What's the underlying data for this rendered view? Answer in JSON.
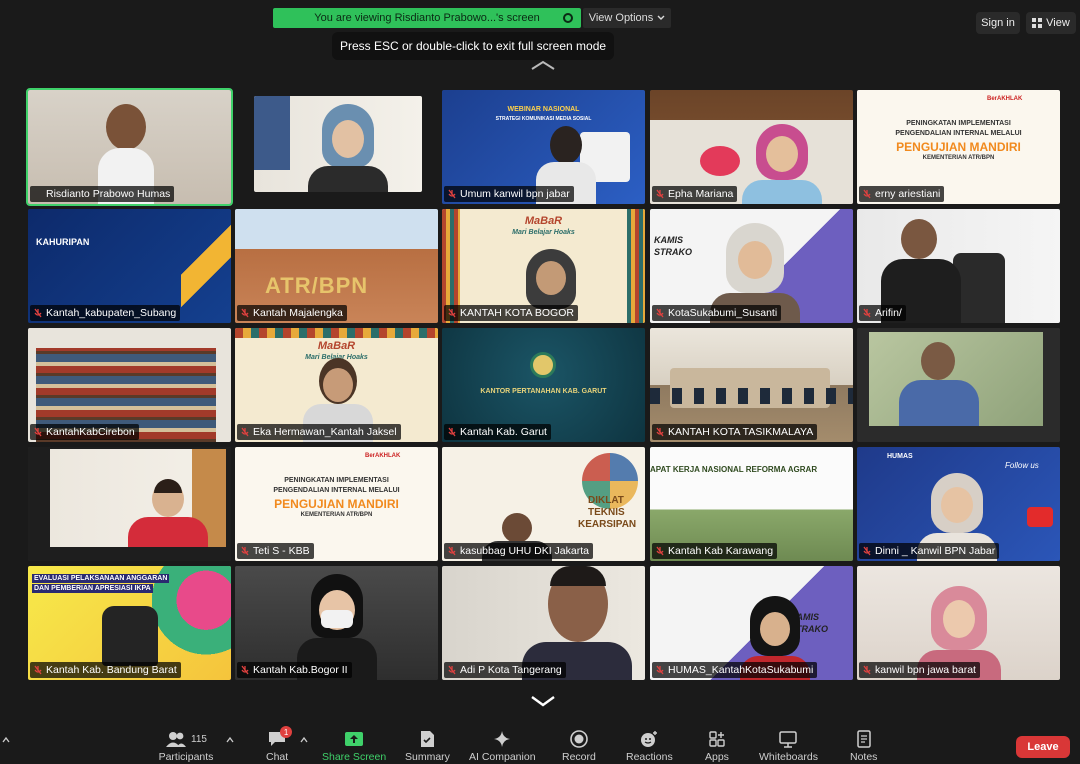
{
  "header": {
    "viewing_banner": "You are viewing Risdianto Prabowo...'s screen",
    "view_options": "View Options",
    "sign_in": "Sign in",
    "view": "View",
    "esc_tip": "Press ESC or double-click to exit full screen mode"
  },
  "tiles": [
    {
      "name": "Risdianto Prabowo Humas",
      "muted": false
    },
    {
      "name": "",
      "muted": false
    },
    {
      "name": "Umum kanwil bpn jabar",
      "muted": true
    },
    {
      "name": "Epha Mariana",
      "muted": true
    },
    {
      "name": "erny ariestiani",
      "muted": true
    },
    {
      "name": "Kantah_kabupaten_Subang",
      "muted": true
    },
    {
      "name": "Kantah Majalengka",
      "muted": true
    },
    {
      "name": "KANTAH KOTA BOGOR",
      "muted": true
    },
    {
      "name": "KotaSukabumi_Susanti",
      "muted": true
    },
    {
      "name": "Arifin/",
      "muted": true
    },
    {
      "name": "KantahKabCirebon",
      "muted": true
    },
    {
      "name": "Eka Hermawan_Kantah Jaksel",
      "muted": true
    },
    {
      "name": "Kantah Kab. Garut",
      "muted": true
    },
    {
      "name": "KANTAH KOTA TASIKMALAYA",
      "muted": true
    },
    {
      "name": "",
      "muted": true
    },
    {
      "name": "",
      "muted": true
    },
    {
      "name": "Teti S - KBB",
      "muted": true
    },
    {
      "name": "kasubbag UHU DKI Jakarta",
      "muted": true
    },
    {
      "name": "Kantah Kab Karawang",
      "muted": true
    },
    {
      "name": "Dinni _ Kanwil BPN Jabar",
      "muted": true
    },
    {
      "name": "Kantah Kab. Bandung Barat",
      "muted": true
    },
    {
      "name": "Kantah Kab.Bogor II",
      "muted": true
    },
    {
      "name": "Adi P Kota Tangerang",
      "muted": true
    },
    {
      "name": "HUMAS_KantahKotaSukabumi",
      "muted": true
    },
    {
      "name": "kanwil bpn jawa barat",
      "muted": true
    }
  ],
  "slides": {
    "webinar": "WEBINAR NASIONAL",
    "webinar_sub": "STRATEGI KOMUNIKASI MEDIA SOSIAL",
    "peningkatan_1": "PENINGKATAN IMPLEMENTASI",
    "peningkatan_2": "PENGENDALIAN INTERNAL MELALUI",
    "pengujian": "PENGUJIAN MANDIRI",
    "kementerian": "KEMENTERIAN ATR/BPN",
    "kahuripan": "KAHURIPAN",
    "atr_bpn": "ATR/BPN",
    "mabar": "MaBaR",
    "mabar_sub": "Mari Belajar Hoaks",
    "kamis": "KAMIS",
    "strako": "STRAKO",
    "kantor_garut": "KANTOR PERTANAHAN KAB. GARUT",
    "diklat_1": "DIKLAT",
    "diklat_2": "TEKNIS",
    "diklat_3": "KEARSIPAN",
    "rapat": "APAT KERJA NASIONAL REFORMA AGRAR",
    "humas": "HUMAS",
    "follow": "Follow us",
    "evaluasi_1": "EVALUASI PELAKSANAAN ANGGARAN",
    "evaluasi_2": "DAN PEMBERIAN APRESIASI IKPA",
    "berakhlak": "BerAKHLAK"
  },
  "toolbar": {
    "participants": "Participants",
    "participants_count": "115",
    "chat": "Chat",
    "chat_badge": "1",
    "share_screen": "Share Screen",
    "summary": "Summary",
    "ai_companion": "AI Companion",
    "record": "Record",
    "reactions": "Reactions",
    "apps": "Apps",
    "whiteboards": "Whiteboards",
    "notes": "Notes",
    "leave": "Leave"
  },
  "colors": {
    "banner_green": "#2fc15a",
    "share_green": "#3fd16a",
    "leave_red": "#d93737",
    "mute_red": "#e0413f"
  }
}
